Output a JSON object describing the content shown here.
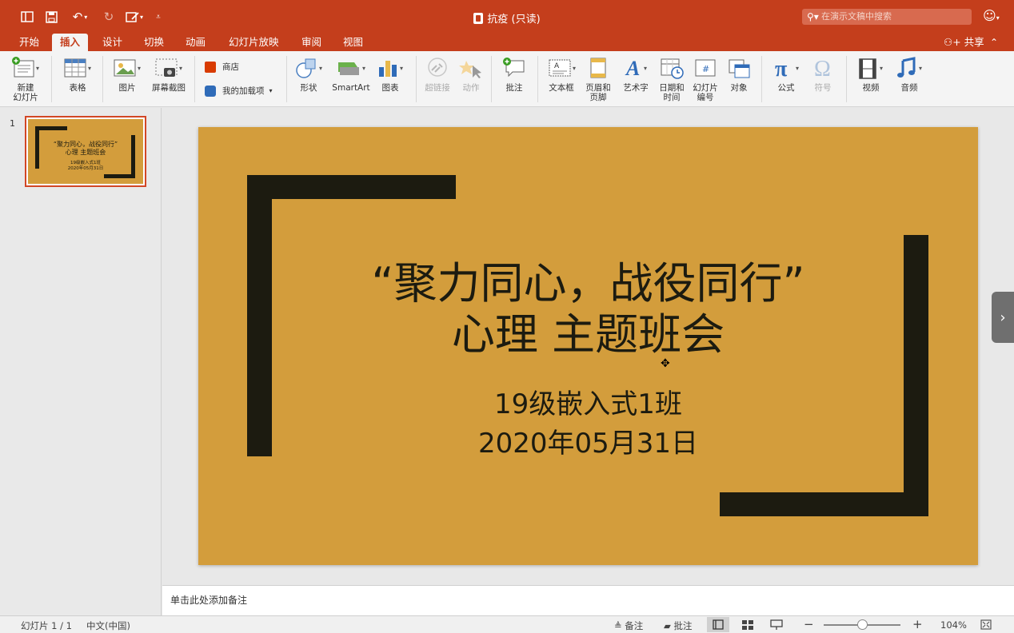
{
  "window": {
    "title": "抗疫 (只读)",
    "search_placeholder": "在演示文稿中搜索"
  },
  "tabs": [
    "开始",
    "插入",
    "设计",
    "切换",
    "动画",
    "幻灯片放映",
    "审阅",
    "视图"
  ],
  "active_tab": "插入",
  "share_label": "共享",
  "ribbon": {
    "new_slide": "新建\n幻灯片",
    "table": "表格",
    "picture": "图片",
    "screenshot": "屏幕截图",
    "store": "商店",
    "my_addins": "我的加载项",
    "shapes": "形状",
    "smartart": "SmartArt",
    "chart": "图表",
    "hyperlink": "超链接",
    "action": "动作",
    "comment": "批注",
    "textbox": "文本框",
    "header_footer": "页眉和\n页脚",
    "wordart": "艺术字",
    "date_time": "日期和\n时间",
    "slide_number": "幻灯片\n编号",
    "object": "对象",
    "equation": "公式",
    "symbol": "符号",
    "video": "视频",
    "audio": "音频"
  },
  "thumbnail": {
    "number": "1"
  },
  "slide": {
    "title_line1": "“聚力同心，战役同行”",
    "title_line2": "心理 主题班会",
    "subtitle_line1": "19级嵌入式1班",
    "subtitle_line2": "2020年05月31日",
    "bg_color": "#d39d3c",
    "bar_color": "#1c1b10"
  },
  "notes_placeholder": "单击此处添加备注",
  "status": {
    "slide_info": "幻灯片 1 / 1",
    "language": "中文(中国)",
    "notes_label": "备注",
    "comments_label": "批注",
    "zoom": "104%"
  },
  "colors": {
    "accent": "#c43e1c"
  }
}
